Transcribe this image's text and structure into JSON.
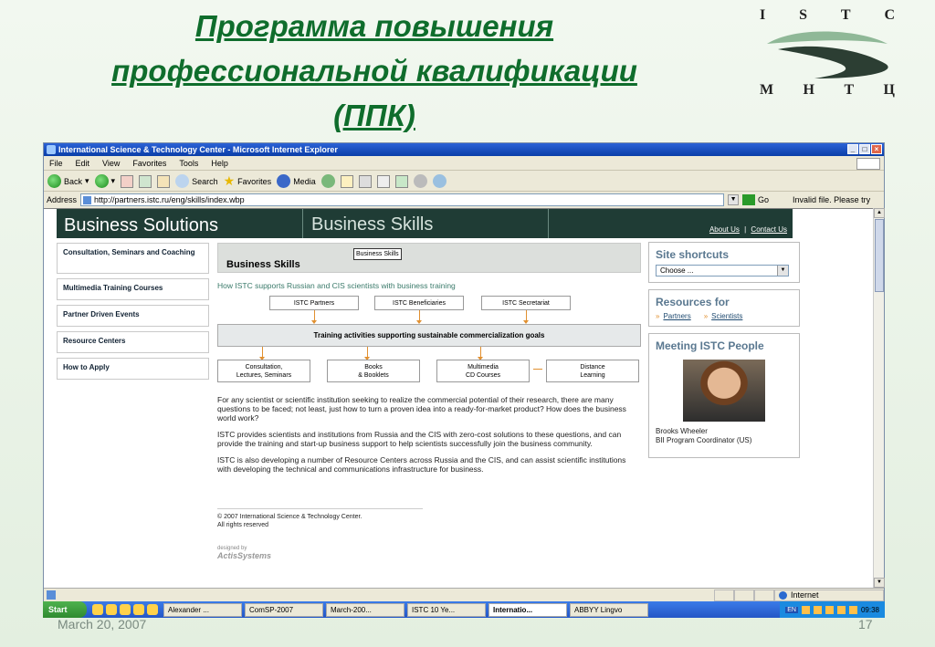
{
  "slide": {
    "title_lines": [
      "Программа повышения",
      "профессиональной квалификации",
      "(ППК)"
    ],
    "logo": {
      "top": [
        "I",
        "S",
        "T",
        "C"
      ],
      "bottom": [
        "М",
        "Н",
        "Т",
        "Ц"
      ]
    },
    "date": "March 20, 2007",
    "page": "17"
  },
  "window": {
    "title": "International Science & Technology Center - Microsoft Internet Explorer",
    "menu": [
      "File",
      "Edit",
      "View",
      "Favorites",
      "Tools",
      "Help"
    ],
    "toolbar": {
      "back": "Back",
      "search": "Search",
      "favorites": "Favorites",
      "media": "Media"
    },
    "address_label": "Address",
    "url": "http://partners.istc.ru/eng/skills/index.wbp",
    "go": "Go",
    "invalid": "Invalid file. Please try"
  },
  "site": {
    "banner": {
      "left": "Business Solutions",
      "right": "Business Skills",
      "about": "About Us",
      "sep": "|",
      "contact": "Contact Us"
    },
    "nav": [
      "Consultation, Seminars and Coaching",
      "Multimedia Training Courses",
      "Partner Driven Events",
      "Resource Centers",
      "How to Apply"
    ],
    "tooltip": "Business Skills",
    "heading": "Business Skills",
    "subtitle": "How ISTC supports Russian and CIS scientists with business training",
    "diagram": {
      "top": [
        "ISTC Partners",
        "ISTC Beneficiaries",
        "ISTC Secretariat"
      ],
      "middle": "Training activities supporting sustainable commercialization goals",
      "bottom": [
        [
          "Consultation,",
          "Lectures, Seminars"
        ],
        [
          "Books",
          "& Booklets"
        ],
        [
          "Multimedia",
          "CD Courses"
        ],
        [
          "Distance",
          "Learning"
        ]
      ]
    },
    "paragraphs": [
      "For any scientist or scientific institution seeking to realize the commercial potential of their research, there are many questions to be faced; not least, just how to turn a proven idea into a ready-for-market product? How does the business world work?",
      "ISTC provides scientists and institutions from Russia and the CIS with zero-cost solutions to these questions, and can provide the training and start-up business support to help scientists successfully join the business community.",
      "ISTC is also developing a number of Resource Centers across Russia and the CIS, and can assist scientific institutions with developing the technical and communications infrastructure for business."
    ],
    "copyright": [
      "© 2007 International Science & Technology Center.",
      "All rights reserved"
    ],
    "designed_by": "designed by",
    "actis": "ActisSystems",
    "shortcuts": {
      "title": "Site shortcuts",
      "select": "Choose ..."
    },
    "resources": {
      "title": "Resources for",
      "links": [
        "Partners",
        "Scientists"
      ]
    },
    "meeting": {
      "title": "Meeting ISTC People",
      "name": "Brooks Wheeler",
      "role": "BII Program Coordinator (US)"
    }
  },
  "status": {
    "zone": "Internet"
  },
  "taskbar": {
    "start": "Start",
    "tasks": [
      "Alexander ...",
      "ComSP-2007",
      "March-200...",
      "ISTC 10 Ye...",
      "Internatio...",
      "ABBYY Lingvo"
    ],
    "lang": "EN",
    "time": "09:38"
  }
}
